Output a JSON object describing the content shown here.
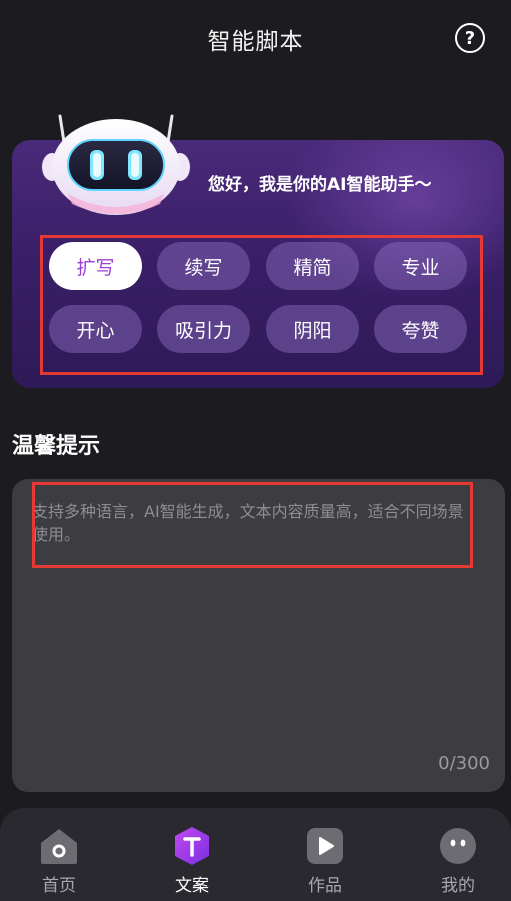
{
  "header": {
    "title": "智能脚本",
    "help_icon": "question-circle-icon",
    "help_glyph": "?"
  },
  "hero": {
    "greeting": "您好，我是你的AI智能助手～",
    "robot_icon": "robot-mascot-icon",
    "chips": [
      {
        "label": "扩写",
        "selected": true
      },
      {
        "label": "续写",
        "selected": false
      },
      {
        "label": "精简",
        "selected": false
      },
      {
        "label": "专业",
        "selected": false
      },
      {
        "label": "开心",
        "selected": false
      },
      {
        "label": "吸引力",
        "selected": false
      },
      {
        "label": "阴阳",
        "selected": false
      },
      {
        "label": "夸赞",
        "selected": false
      }
    ]
  },
  "tips": {
    "title": "温馨提示",
    "placeholder": "支持多种语言，AI智能生成，文本内容质量高，适合不同场景使用。",
    "counter": "0/300"
  },
  "tabbar": {
    "items": [
      {
        "label": "首页",
        "icon": "home-icon",
        "active": false
      },
      {
        "label": "文案",
        "icon": "text-t-icon",
        "active": true
      },
      {
        "label": "作品",
        "icon": "play-icon",
        "active": false
      },
      {
        "label": "我的",
        "icon": "profile-face-icon",
        "active": false
      }
    ]
  },
  "colors": {
    "background": "#1c1b1f",
    "accent": "#9b3fd6",
    "card": "#3d3c40",
    "annotation_box": "#e53935"
  }
}
